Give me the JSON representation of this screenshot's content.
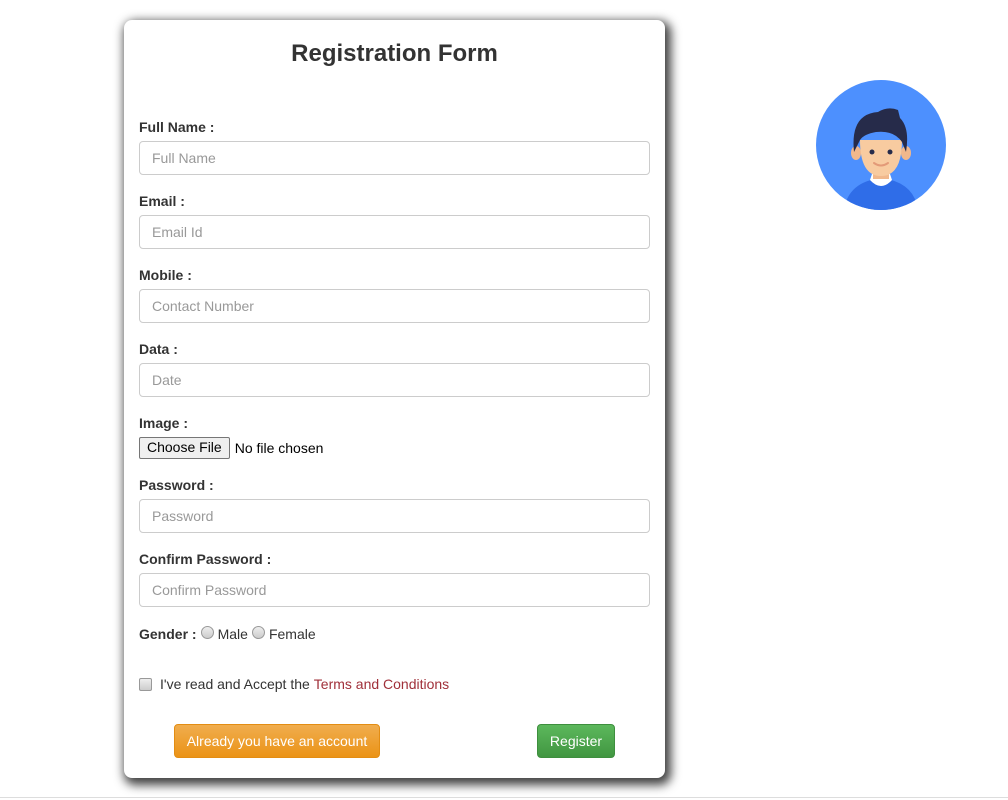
{
  "form": {
    "title": "Registration Form",
    "fields": [
      {
        "label": "Full Name :",
        "placeholder": "Full Name",
        "value": ""
      },
      {
        "label": "Email :",
        "placeholder": "Email Id",
        "value": ""
      },
      {
        "label": "Mobile :",
        "placeholder": "Contact Number",
        "value": ""
      },
      {
        "label": "Data :",
        "placeholder": "Date",
        "value": ""
      }
    ],
    "image": {
      "label": "Image :",
      "button": "Choose File",
      "status": "No file chosen"
    },
    "password": {
      "label": "Password :",
      "placeholder": "Password",
      "value": ""
    },
    "confirm": {
      "label": "Confirm Password :",
      "placeholder": "Confirm Password",
      "value": ""
    },
    "gender": {
      "label": "Gender :",
      "options": [
        "Male",
        "Female"
      ]
    },
    "terms": {
      "text": "I've read and Accept the",
      "link": "Terms and Conditions",
      "checked": false
    },
    "buttons": {
      "login": "Already you have an account",
      "register": "Register"
    }
  },
  "colors": {
    "login_button": "#f0ad4e",
    "register_button": "#5cb85c",
    "link": "#a0303a",
    "avatar_bg": "#4d90fe"
  },
  "avatar": {
    "icon": "user-avatar-icon"
  }
}
